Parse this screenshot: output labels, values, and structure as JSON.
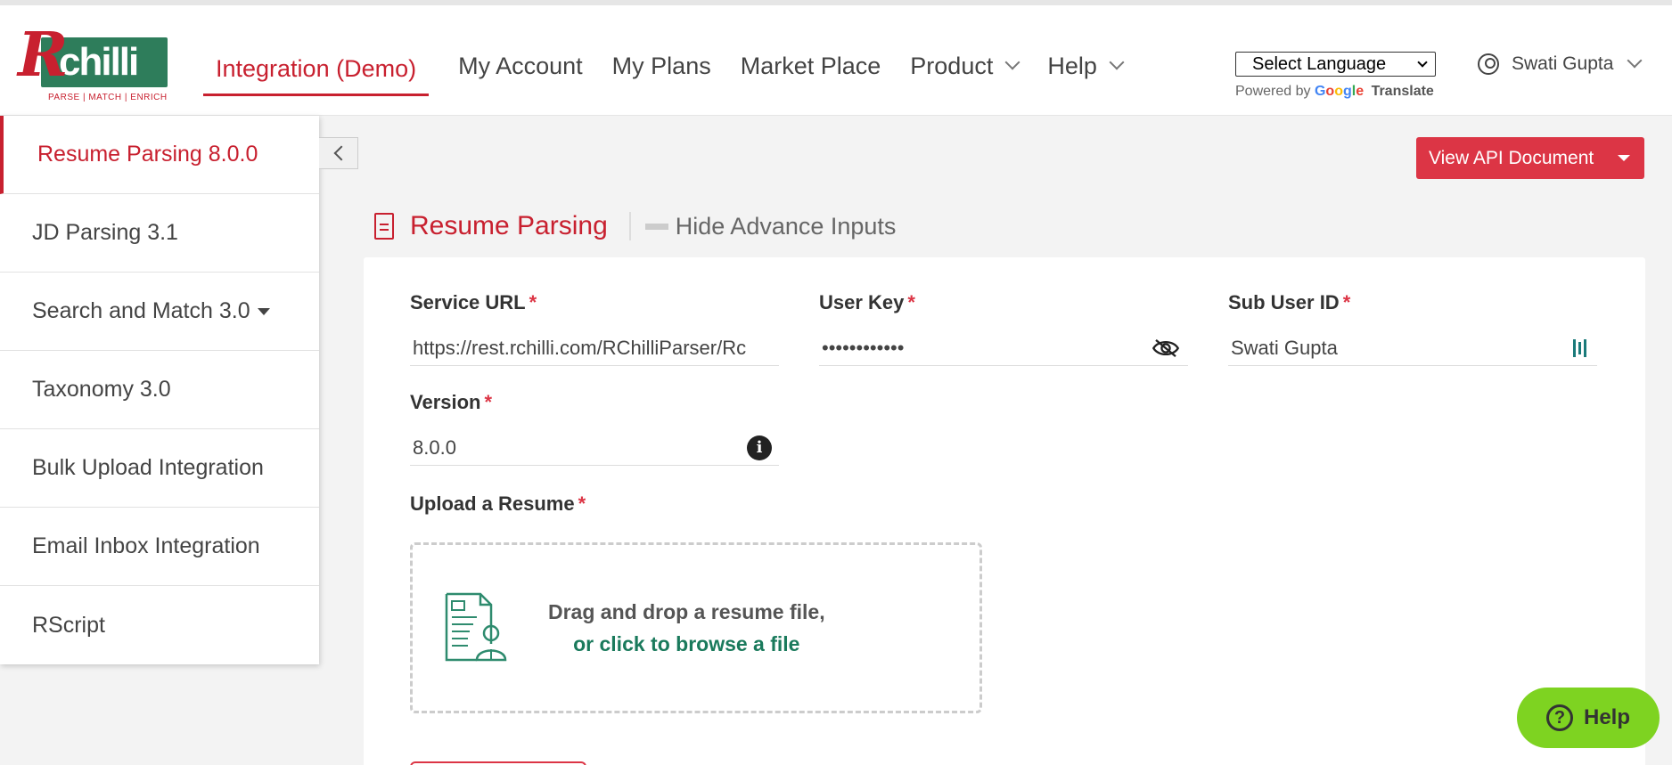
{
  "logo": {
    "letter": "R",
    "word": "chilli",
    "tagline": "PARSE | MATCH | ENRICH"
  },
  "nav": {
    "items": [
      {
        "label": "Integration (Demo)"
      },
      {
        "label": "My Account"
      },
      {
        "label": "My Plans"
      },
      {
        "label": "Market Place"
      },
      {
        "label": "Product"
      },
      {
        "label": "Help"
      }
    ]
  },
  "language": {
    "selected": "Select Language",
    "powered_by": "Powered by",
    "google": "Google",
    "translate": "Translate"
  },
  "user": {
    "name": "Swati Gupta"
  },
  "sidebar": {
    "items": [
      {
        "label": "Resume Parsing 8.0.0"
      },
      {
        "label": "JD Parsing 3.1"
      },
      {
        "label": "Search and Match 3.0"
      },
      {
        "label": "Taxonomy 3.0"
      },
      {
        "label": "Bulk Upload Integration"
      },
      {
        "label": "Email Inbox Integration"
      },
      {
        "label": "RScript"
      }
    ]
  },
  "toolbar": {
    "api_doc_label": "View API Document"
  },
  "section": {
    "title": "Resume Parsing",
    "toggle_label": "Hide Advance Inputs"
  },
  "form": {
    "service_url": {
      "label": "Service URL",
      "value": "https://rest.rchilli.com/RChilliParser/Rc"
    },
    "user_key": {
      "label": "User Key",
      "value": "••••••••••••"
    },
    "sub_user_id": {
      "label": "Sub User ID",
      "value": "Swati Gupta"
    },
    "version": {
      "label": "Version",
      "value": "8.0.0"
    },
    "upload": {
      "label": "Upload a Resume",
      "line1": "Drag and drop a resume file,",
      "line2": "or click to browse a file"
    },
    "required_mark": "*"
  },
  "help_widget": {
    "label": "Help"
  },
  "colors": {
    "brand_red": "#c8202f",
    "button_red": "#dc3545",
    "brand_green": "#2e7d5b",
    "help_green": "#7ed321"
  }
}
